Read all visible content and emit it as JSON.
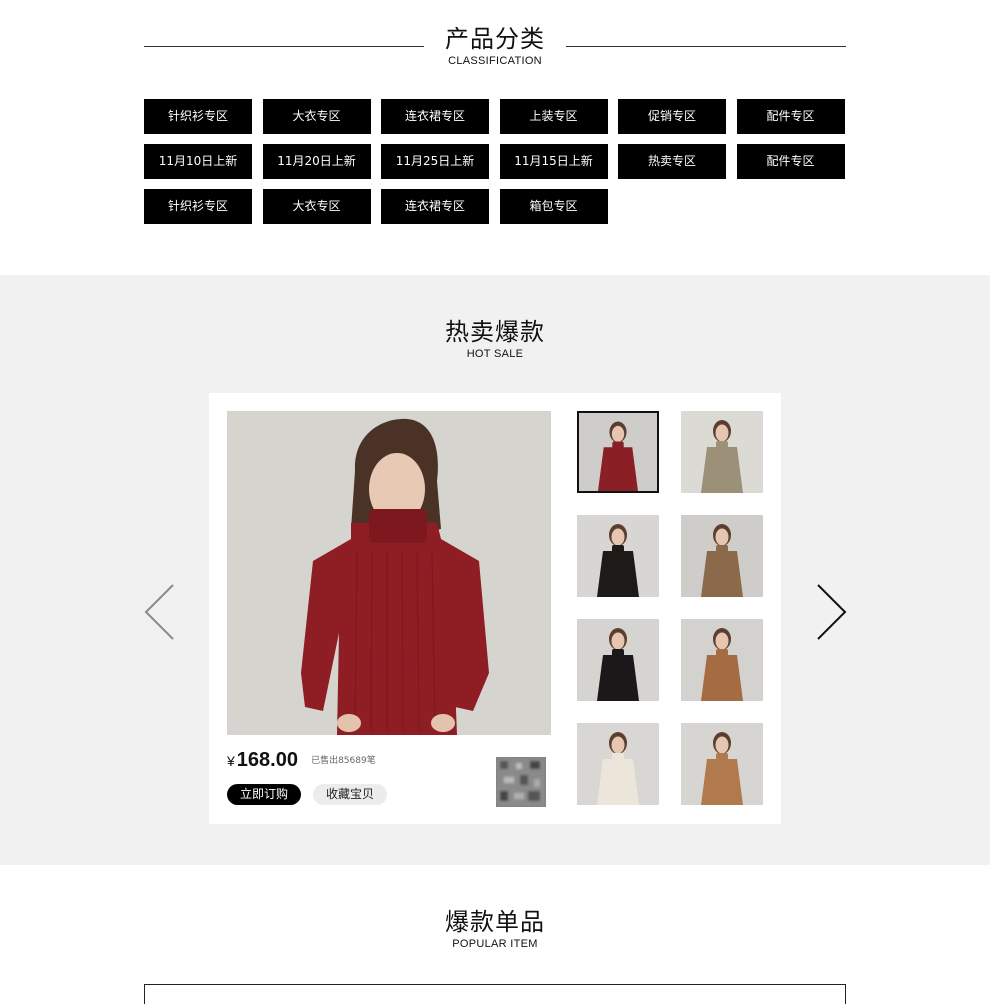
{
  "classification": {
    "title_cn": "产品分类",
    "title_en": "CLASSIFICATION",
    "categories": [
      "针织衫专区",
      "大衣专区",
      "连衣裙专区",
      "上装专区",
      "促销专区",
      "配件专区",
      "11月10日上新",
      "11月20日上新",
      "11月25日上新",
      "11月15日上新",
      "热卖专区",
      "配件专区",
      "针织衫专区",
      "大衣专区",
      "连衣裙专区",
      "箱包专区"
    ]
  },
  "hot_sale": {
    "title_cn": "热卖爆款",
    "title_en": "HOT SALE",
    "product": {
      "currency": "¥",
      "price": "168.00",
      "sold": "已售出85689笔",
      "order_label": "立即订购",
      "favorite_label": "收藏宝贝",
      "main_color": "#8e1d24"
    },
    "thumbnails": [
      {
        "garment": "red turtleneck sweater",
        "color": "#8a1f26",
        "bg": "#cfcdca",
        "active": true
      },
      {
        "garment": "beige cable knit",
        "color": "#9c9079",
        "bg": "#dcdad5",
        "active": false
      },
      {
        "garment": "black shearling jacket",
        "color": "#1d1a18",
        "bg": "#d8d6d2",
        "active": false
      },
      {
        "garment": "brown teddy jacket",
        "color": "#8a6a4a",
        "bg": "#cfcdc9",
        "active": false
      },
      {
        "garment": "black cape coat",
        "color": "#1a1818",
        "bg": "#d6d4d0",
        "active": false
      },
      {
        "garment": "camel wrap coat",
        "color": "#a56b42",
        "bg": "#d4d2ce",
        "active": false
      },
      {
        "garment": "cream knit sweater",
        "color": "#ece6da",
        "bg": "#d9d7d3",
        "active": false
      },
      {
        "garment": "camel double-breasted coat",
        "color": "#b07a4c",
        "bg": "#d7d5d1",
        "active": false
      }
    ],
    "prev_icon": "chevron-left",
    "next_icon": "chevron-right"
  },
  "popular": {
    "title_cn": "爆款单品",
    "title_en": "POPULAR ITEM"
  }
}
